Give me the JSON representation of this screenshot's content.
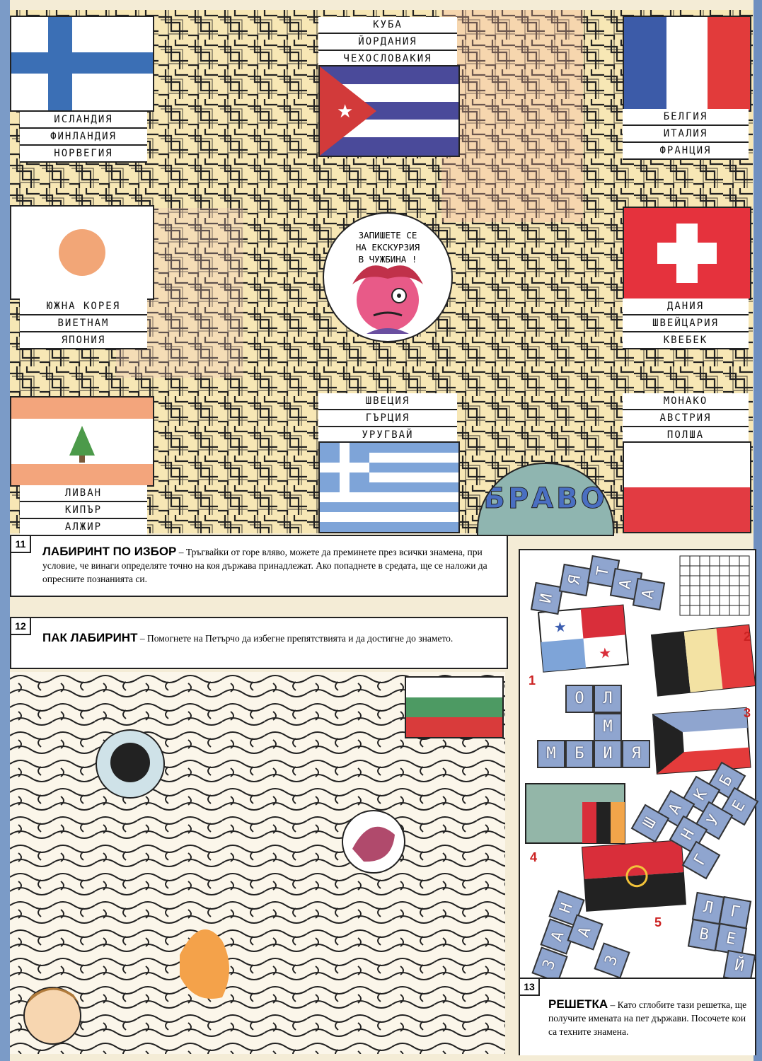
{
  "maze11": {
    "groups": {
      "top_left": [
        "ИСЛАНДИЯ",
        "ФИНЛАНДИЯ",
        "НОРВЕГИЯ"
      ],
      "top_center": [
        "КУБА",
        "ЙОРДАНИЯ",
        "ЧЕХОСЛОВАКИЯ"
      ],
      "top_right": [
        "БЕЛГИЯ",
        "ИТАЛИЯ",
        "ФРАНЦИЯ"
      ],
      "mid_left": [
        "ЮЖНА КОРЕЯ",
        "ВИЕТНАМ",
        "ЯПОНИЯ"
      ],
      "mid_right": [
        "ДАНИЯ",
        "ШВЕЙЦАРИЯ",
        "КВЕБЕК"
      ],
      "bot_left": [
        "ЛИВАН",
        "КИПЪР",
        "АЛЖИР"
      ],
      "bot_center": [
        "ШВЕЦИЯ",
        "ГЪРЦИЯ",
        "УРУГВАЙ"
      ],
      "bot_right": [
        "МОНАКО",
        "АВСТРИЯ",
        "ПОЛША"
      ]
    },
    "speech": [
      "ЗАПИШЕТЕ СЕ",
      "НА ЕКСКУРЗИЯ",
      "В ЧУЖБИНА !"
    ],
    "badge": "БРАВО",
    "number": "11",
    "title": "ЛАБИРИНТ ПО ИЗБОР",
    "text": "– Тръгвайки от горе вляво, можете да преминете през всички знамена, при условие, че винаги определяте точно на коя държава принадлежат. Ако попаднете в средата, ще се наложи да опресните познанията си."
  },
  "maze12": {
    "number": "12",
    "title": "ПАК ЛАБИРИНТ",
    "text": "– Помогнете на Петърчо да избегне препятствията и да достигне до знамето."
  },
  "puzzle13": {
    "number": "13",
    "title": "РЕШЕТКА",
    "text": "– Като сглобите тази решетка, ще получите имената на пет държави. Посочете кои са техните знамена.",
    "flag_numbers": [
      "1",
      "2",
      "3",
      "4",
      "5"
    ],
    "tiles": [
      "И",
      "Я",
      "Т",
      "А",
      "А",
      "О",
      "Л",
      "М",
      "М",
      "Б",
      "И",
      "Я",
      "Б",
      "Е",
      "К",
      "У",
      "А",
      "Н",
      "Г",
      "Ш",
      "Л",
      "Г",
      "В",
      "Е",
      "Й",
      "З",
      "А",
      "Н",
      "А",
      "З"
    ]
  }
}
